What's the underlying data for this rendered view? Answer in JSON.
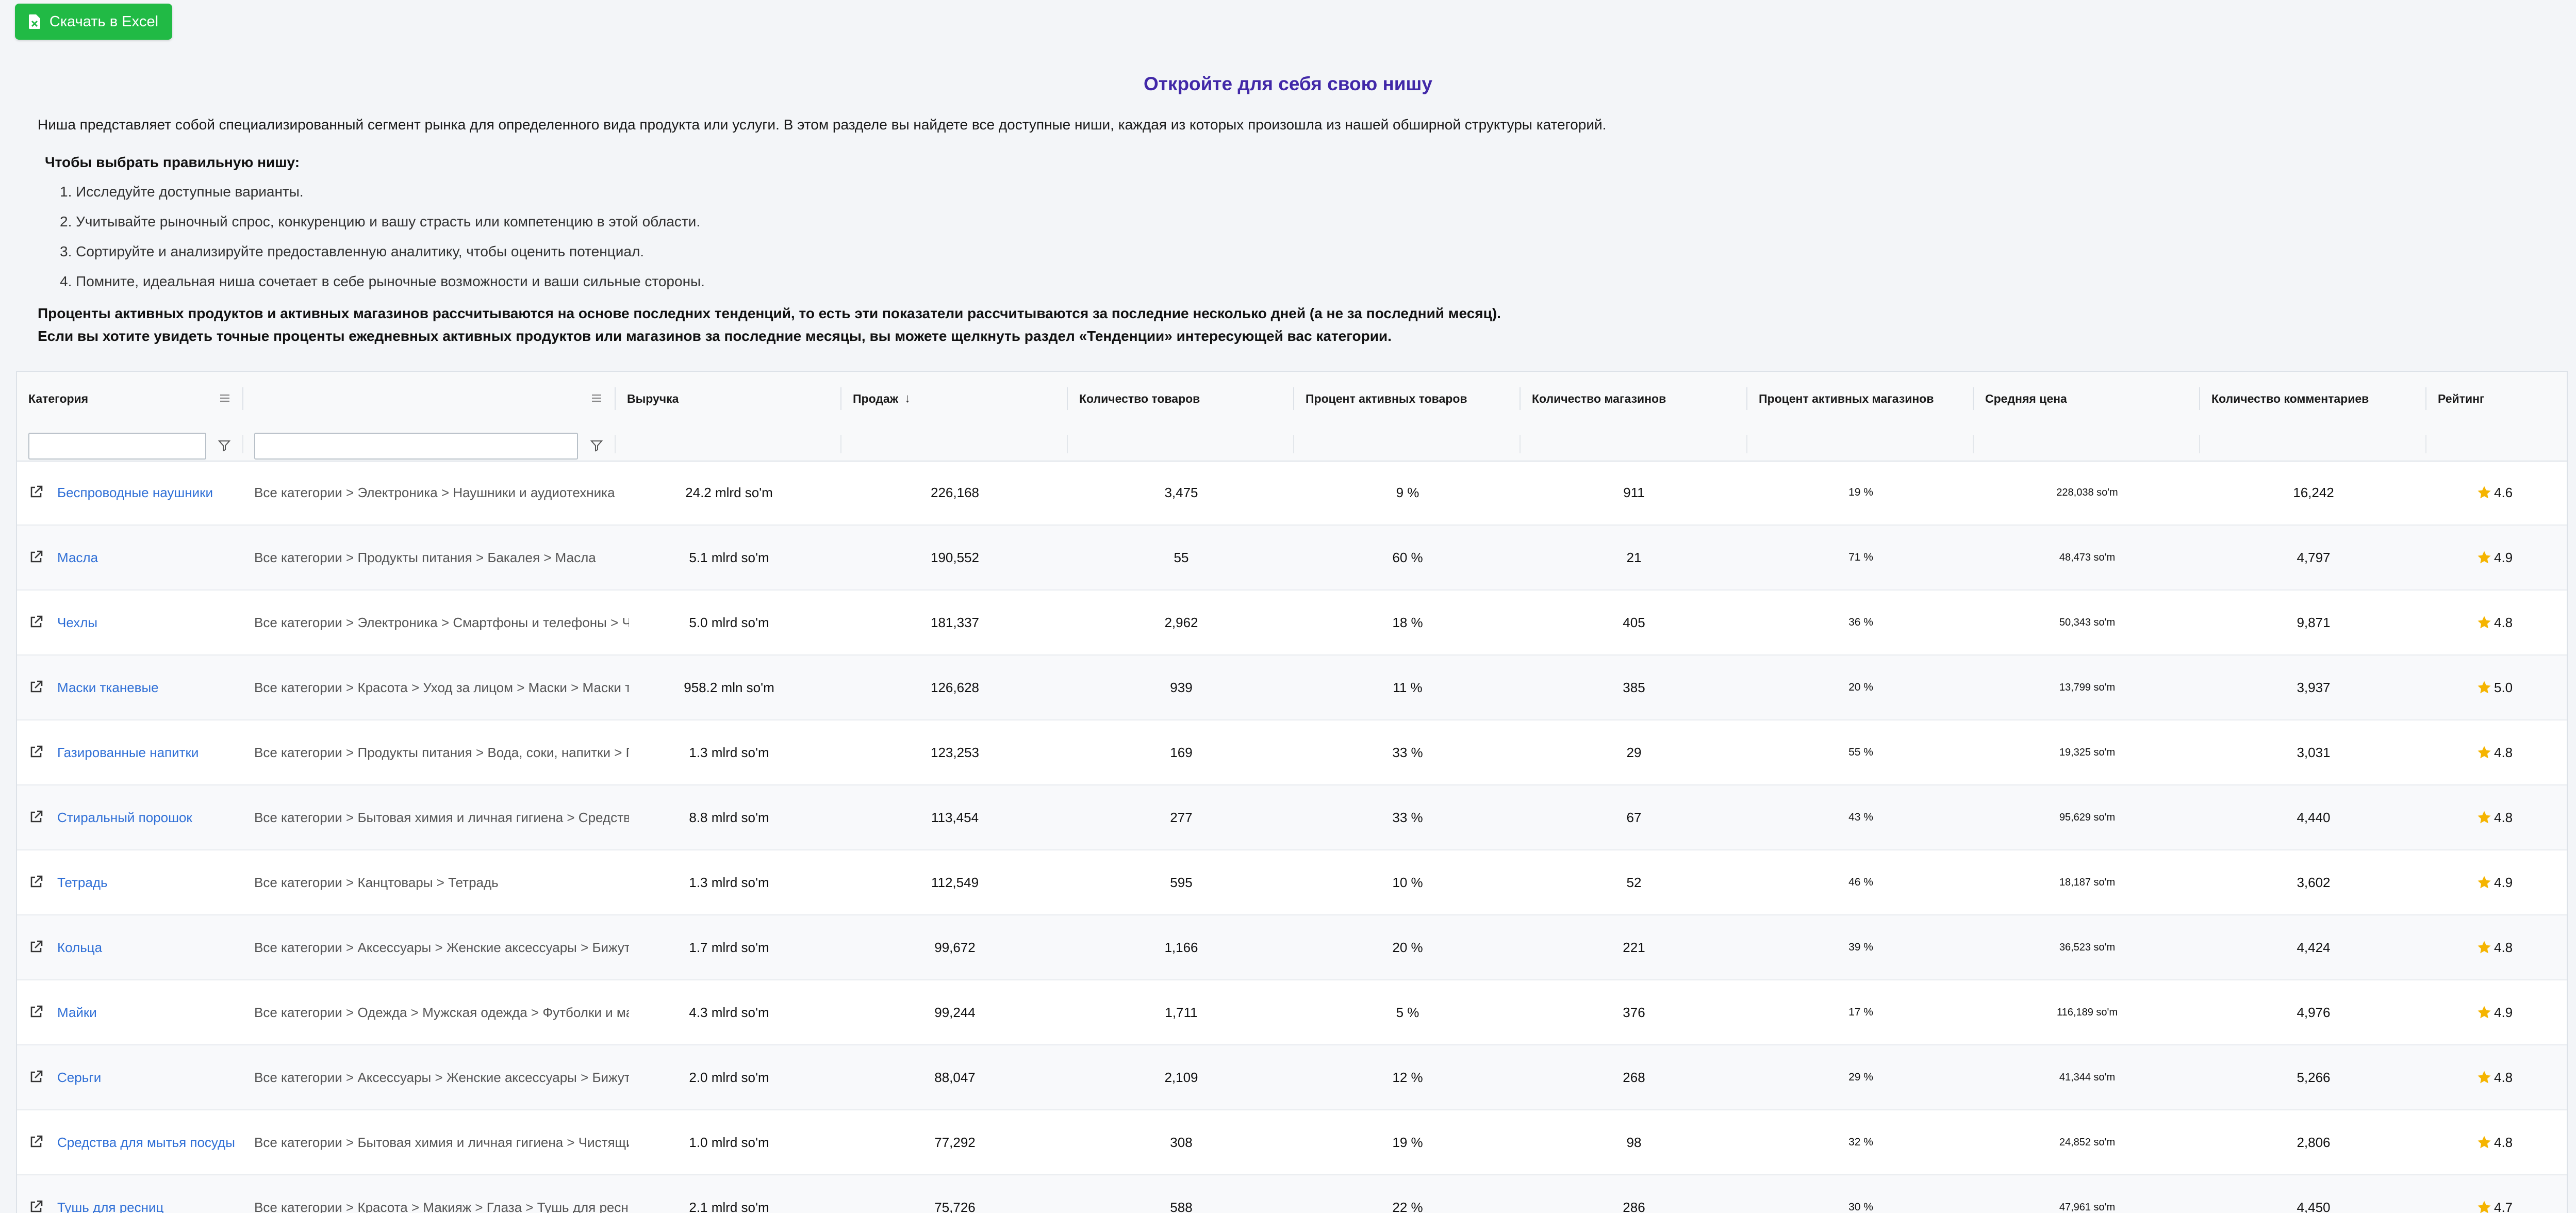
{
  "toolbar": {
    "excel_label": "Скачать в Excel",
    "excel_color": "#21ba45"
  },
  "header": {
    "title": "Откройте для себя свою нишу",
    "title_color": "#4128a8",
    "intro": "Ниша представляет собой специализированный сегмент рынка для определенного вида продукта или услуги. В этом разделе вы найдете все доступные ниши, каждая из которых произошла из нашей обширной структуры категорий.",
    "howto_title": "Чтобы выбрать правильную нишу:",
    "steps": [
      "1. Исследуйте доступные варианты.",
      "2. Учитывайте рыночный спрос, конкуренцию и вашу страсть или компетенцию в этой области.",
      "3. Сортируйте и анализируйте предоставленную аналитику, чтобы оценить потенциал.",
      "4. Помните, идеальная ниша сочетает в себе рыночные возможности и ваши сильные стороны."
    ],
    "note1": "Проценты активных продуктов и активных магазинов рассчитываются на основе последних тенденций, то есть эти показатели рассчитываются за последние несколько дней (а не за последний месяц).",
    "note2": "Если вы хотите увидеть точные проценты ежедневных активных продуктов или магазинов за последние месяцы, вы можете щелкнуть раздел «Тенденции» интересующей вас категории."
  },
  "table": {
    "columns": {
      "category": "Категория",
      "path": "",
      "revenue": "Выручка",
      "sales": "Продаж",
      "sales_sort": "↓",
      "products": "Количество товаров",
      "active_products": "Процент активных товаров",
      "shops": "Количество магазинов",
      "active_shops": "Процент активных магазинов",
      "avg_price": "Средняя цена",
      "comments": "Количество комментариев",
      "rating": "Рейтинг"
    },
    "filters": {
      "category_value": "",
      "path_value": ""
    },
    "star_color": "#f5b400",
    "link_color": "#2f6fd6",
    "rows": [
      {
        "category": "Беспроводные наушники",
        "path": "Все категории > Электроника > Наушники и аудиотехника",
        "revenue": "24.2 mlrd so'm",
        "sales": "226,168",
        "products": "3,475",
        "active_products": "9 %",
        "shops": "911",
        "active_shops": "19 %",
        "avg_price": "228,038 so'm",
        "comments": "16,242",
        "rating": "4.6"
      },
      {
        "category": "Масла",
        "path": "Все категории > Продукты питания > Бакалея > Масла",
        "revenue": "5.1 mlrd so'm",
        "sales": "190,552",
        "products": "55",
        "active_products": "60 %",
        "shops": "21",
        "active_shops": "71 %",
        "avg_price": "48,473 so'm",
        "comments": "4,797",
        "rating": "4.9"
      },
      {
        "category": "Чехлы",
        "path": "Все категории > Электроника > Смартфоны и телефоны > Чехлы",
        "revenue": "5.0 mlrd so'm",
        "sales": "181,337",
        "products": "2,962",
        "active_products": "18 %",
        "shops": "405",
        "active_shops": "36 %",
        "avg_price": "50,343 so'm",
        "comments": "9,871",
        "rating": "4.8"
      },
      {
        "category": "Маски тканевые",
        "path": "Все категории > Красота > Уход за лицом > Маски > Маски тканевые",
        "revenue": "958.2 mln so'm",
        "sales": "126,628",
        "products": "939",
        "active_products": "11 %",
        "shops": "385",
        "active_shops": "20 %",
        "avg_price": "13,799 so'm",
        "comments": "3,937",
        "rating": "5.0"
      },
      {
        "category": "Газированные напитки",
        "path": "Все категории > Продукты питания > Вода, соки, напитки > Газированные напитки",
        "revenue": "1.3 mlrd so'm",
        "sales": "123,253",
        "products": "169",
        "active_products": "33 %",
        "shops": "29",
        "active_shops": "55 %",
        "avg_price": "19,325 so'm",
        "comments": "3,031",
        "rating": "4.8"
      },
      {
        "category": "Стиральный порошок",
        "path": "Все категории > Бытовая химия и личная гигиена > Средства для стирки",
        "revenue": "8.8 mlrd so'm",
        "sales": "113,454",
        "products": "277",
        "active_products": "33 %",
        "shops": "67",
        "active_shops": "43 %",
        "avg_price": "95,629 so'm",
        "comments": "4,440",
        "rating": "4.8"
      },
      {
        "category": "Тетрадь",
        "path": "Все категории > Канцтовары > Тетрадь",
        "revenue": "1.3 mlrd so'm",
        "sales": "112,549",
        "products": "595",
        "active_products": "10 %",
        "shops": "52",
        "active_shops": "46 %",
        "avg_price": "18,187 so'm",
        "comments": "3,602",
        "rating": "4.9"
      },
      {
        "category": "Кольца",
        "path": "Все категории > Аксессуары > Женские аксессуары > Бижутерия > Кольца",
        "revenue": "1.7 mlrd so'm",
        "sales": "99,672",
        "products": "1,166",
        "active_products": "20 %",
        "shops": "221",
        "active_shops": "39 %",
        "avg_price": "36,523 so'm",
        "comments": "4,424",
        "rating": "4.8"
      },
      {
        "category": "Майки",
        "path": "Все категории > Одежда > Мужская одежда > Футболки и майки",
        "revenue": "4.3 mlrd so'm",
        "sales": "99,244",
        "products": "1,711",
        "active_products": "5 %",
        "shops": "376",
        "active_shops": "17 %",
        "avg_price": "116,189 so'm",
        "comments": "4,976",
        "rating": "4.9"
      },
      {
        "category": "Серьги",
        "path": "Все категории > Аксессуары > Женские аксессуары > Бижутерия > Серьги",
        "revenue": "2.0 mlrd so'm",
        "sales": "88,047",
        "products": "2,109",
        "active_products": "12 %",
        "shops": "268",
        "active_shops": "29 %",
        "avg_price": "41,344 so'm",
        "comments": "5,266",
        "rating": "4.8"
      },
      {
        "category": "Средства для мытья посуды",
        "path": "Все категории > Бытовая химия и личная гигиена > Чистящие средства",
        "revenue": "1.0 mlrd so'm",
        "sales": "77,292",
        "products": "308",
        "active_products": "19 %",
        "shops": "98",
        "active_shops": "32 %",
        "avg_price": "24,852 so'm",
        "comments": "2,806",
        "rating": "4.8"
      },
      {
        "category": "Тушь для ресниц",
        "path": "Все категории > Красота > Макияж > Глаза > Тушь для ресниц",
        "revenue": "2.1 mlrd so'm",
        "sales": "75,726",
        "products": "588",
        "active_products": "22 %",
        "shops": "286",
        "active_shops": "30 %",
        "avg_price": "47,961 so'm",
        "comments": "4,450",
        "rating": "4.7"
      }
    ]
  }
}
